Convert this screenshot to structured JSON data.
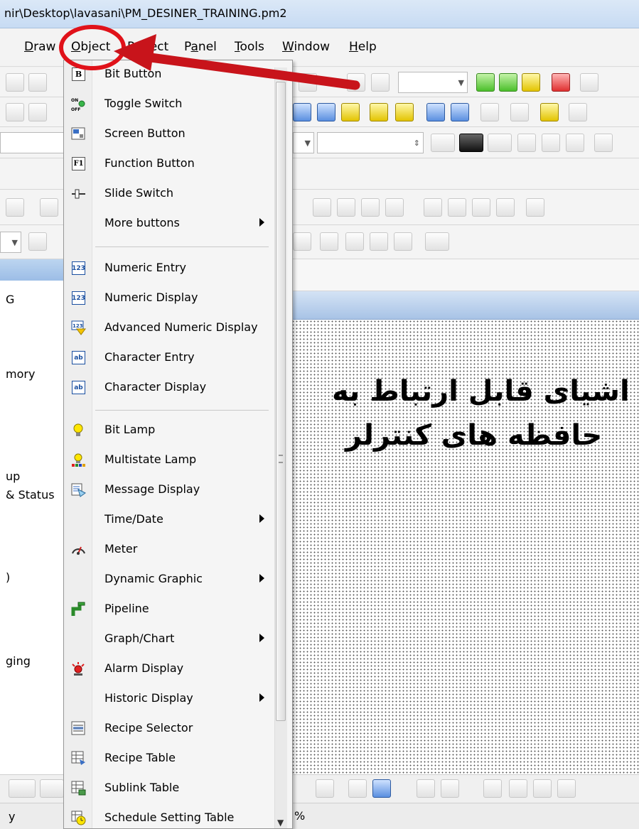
{
  "window": {
    "title": "nir\\Desktop\\lavasani\\PM_DESINER_TRAINING.pm2"
  },
  "menubar": {
    "items": [
      {
        "label": "Draw",
        "mnemonic_index": 0
      },
      {
        "label": "Object",
        "mnemonic_index": 0
      },
      {
        "label": "Project",
        "mnemonic_index": 0
      },
      {
        "label": "Panel",
        "mnemonic_index": 1
      },
      {
        "label": "Tools",
        "mnemonic_index": 0
      },
      {
        "label": "Window",
        "mnemonic_index": 0
      },
      {
        "label": "Help",
        "mnemonic_index": 0
      }
    ]
  },
  "object_menu": {
    "items": [
      {
        "label": "Bit Button",
        "icon": "bit-button-icon",
        "submenu": false
      },
      {
        "label": "Toggle Switch",
        "icon": "toggle-switch-icon",
        "submenu": false
      },
      {
        "label": "Screen Button",
        "icon": "screen-button-icon",
        "submenu": false
      },
      {
        "label": "Function Button",
        "icon": "function-button-icon",
        "submenu": false
      },
      {
        "label": "Slide Switch",
        "icon": "slide-switch-icon",
        "submenu": false
      },
      {
        "label": "More buttons",
        "icon": "",
        "submenu": true
      },
      {
        "label": "Numeric Entry",
        "icon": "numeric-entry-icon",
        "submenu": false
      },
      {
        "label": "Numeric Display",
        "icon": "numeric-display-icon",
        "submenu": false
      },
      {
        "label": "Advanced Numeric Display",
        "icon": "advanced-numeric-display-icon",
        "submenu": false
      },
      {
        "label": "Character Entry",
        "icon": "character-entry-icon",
        "submenu": false
      },
      {
        "label": "Character Display",
        "icon": "character-display-icon",
        "submenu": false
      },
      {
        "label": "Bit Lamp",
        "icon": "bit-lamp-icon",
        "submenu": false
      },
      {
        "label": "Multistate Lamp",
        "icon": "multistate-lamp-icon",
        "submenu": false
      },
      {
        "label": "Message Display",
        "icon": "message-display-icon",
        "submenu": false
      },
      {
        "label": "Time/Date",
        "icon": "",
        "submenu": true
      },
      {
        "label": "Meter",
        "icon": "meter-icon",
        "submenu": false
      },
      {
        "label": "Dynamic Graphic",
        "icon": "",
        "submenu": true
      },
      {
        "label": "Pipeline",
        "icon": "pipeline-icon",
        "submenu": false
      },
      {
        "label": "Graph/Chart",
        "icon": "",
        "submenu": true
      },
      {
        "label": "Alarm Display",
        "icon": "alarm-display-icon",
        "submenu": false
      },
      {
        "label": "Historic Display",
        "icon": "",
        "submenu": true
      },
      {
        "label": "Recipe Selector",
        "icon": "recipe-selector-icon",
        "submenu": false
      },
      {
        "label": "Recipe Table",
        "icon": "recipe-table-icon",
        "submenu": false
      },
      {
        "label": "Sublink Table",
        "icon": "sublink-table-icon",
        "submenu": false
      },
      {
        "label": "Schedule Setting Table",
        "icon": "schedule-setting-table-icon",
        "submenu": false
      }
    ]
  },
  "left_panel": {
    "fragments": [
      "G",
      "mory",
      "up",
      "& Status",
      ")",
      "ging"
    ]
  },
  "canvas": {
    "annotation_line1": "اشیای قابل ارتباط به",
    "annotation_line2": "حافظه های کنترلر"
  },
  "status": {
    "left": "y",
    "right": "%"
  },
  "colors": {
    "highlight_circle": "#e0121a",
    "arrow": "#c8141b"
  }
}
